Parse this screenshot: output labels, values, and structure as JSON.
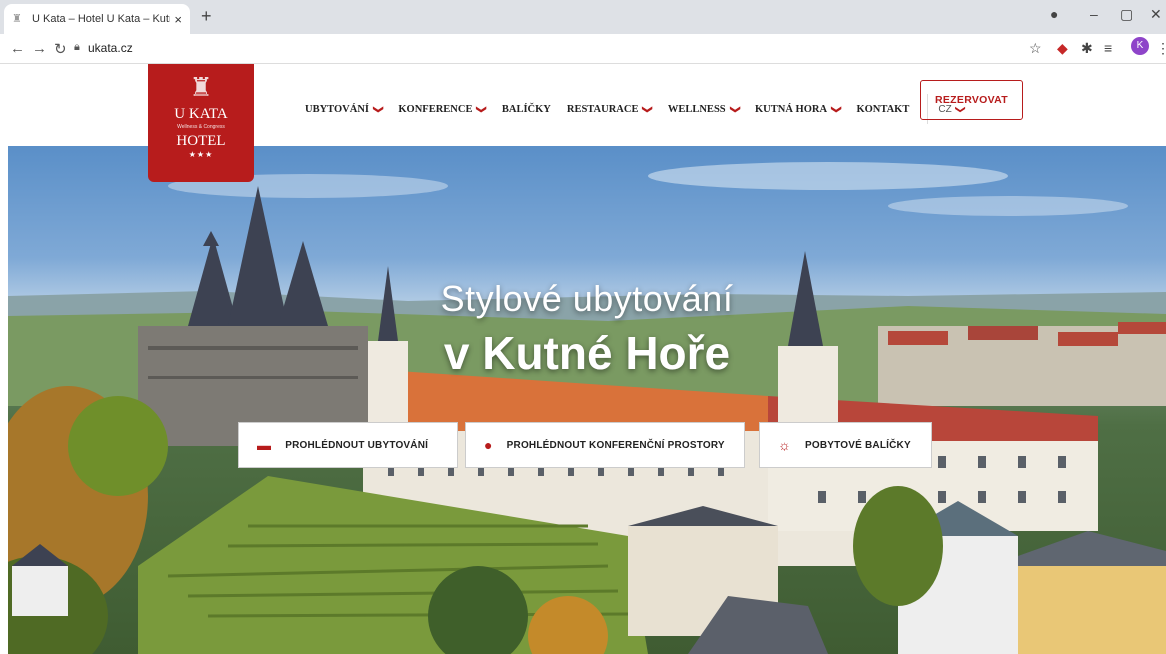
{
  "browser": {
    "tab_title": "U Kata – Hotel U Kata – Kutná H",
    "tab_close": "×",
    "new_tab": "+",
    "url": "ukata.cz",
    "profile_initial": "K"
  },
  "logo": {
    "line1": "U KATA",
    "line2": "Wellness & Congress",
    "line3": "HOTEL",
    "stars": "★★★"
  },
  "nav": {
    "items": [
      {
        "label": "UBYTOVÁNÍ",
        "has_dropdown": true
      },
      {
        "label": "KONFERENCE",
        "has_dropdown": true
      },
      {
        "label": "BALÍČKY",
        "has_dropdown": false
      },
      {
        "label": "RESTAURACE",
        "has_dropdown": true
      },
      {
        "label": "WELLNESS",
        "has_dropdown": true
      },
      {
        "label": "KUTNÁ HORA",
        "has_dropdown": true
      },
      {
        "label": "KONTAKT",
        "has_dropdown": false
      }
    ],
    "language": "CZ",
    "reserve_label": "REZERVOVAT"
  },
  "hero": {
    "title_line1": "Stylové ubytování",
    "title_line2": "v Kutné Hoře"
  },
  "cta_buttons": [
    {
      "label": "PROHLÉDNOUT UBYTOVÁNÍ",
      "icon": "bed-icon"
    },
    {
      "label": "PROHLÉDNOUT KONFERENČNÍ PROSTORY",
      "icon": "person-icon"
    },
    {
      "label": "POBYTOVÉ BALÍČKY",
      "icon": "sun-icon"
    }
  ],
  "colors": {
    "brand_red": "#b71c1c"
  }
}
